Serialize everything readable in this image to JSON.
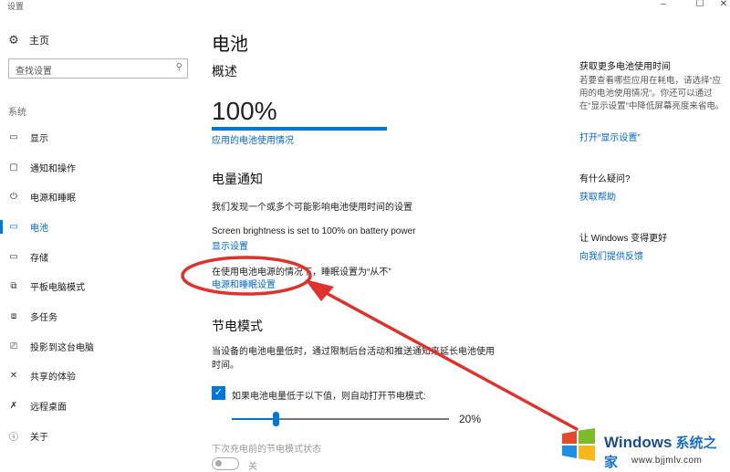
{
  "window": {
    "title": "设置",
    "controls": {
      "minimize": "–",
      "maximize": "☐",
      "close": "✕"
    }
  },
  "sidebar": {
    "home_label": "主页",
    "search_placeholder": "查找设置",
    "section_label": "系统",
    "items": [
      {
        "label": "显示",
        "icon": "monitor-icon",
        "glyph": "▭"
      },
      {
        "label": "通知和操作",
        "icon": "notification-icon",
        "glyph": "▢"
      },
      {
        "label": "电源和睡眠",
        "icon": "power-icon",
        "glyph": "⏻"
      },
      {
        "label": "电池",
        "icon": "battery-icon",
        "glyph": "▭",
        "active": true
      },
      {
        "label": "存储",
        "icon": "storage-icon",
        "glyph": "▭"
      },
      {
        "label": "平板电脑模式",
        "icon": "tablet-icon",
        "glyph": "⧉"
      },
      {
        "label": "多任务",
        "icon": "multitask-icon",
        "glyph": "⧈"
      },
      {
        "label": "投影到这台电脑",
        "icon": "project-icon",
        "glyph": "⎚"
      },
      {
        "label": "共享的体验",
        "icon": "share-icon",
        "glyph": "✕"
      },
      {
        "label": "远程桌面",
        "icon": "remote-desktop-icon",
        "glyph": "✗"
      },
      {
        "label": "关于",
        "icon": "info-icon",
        "glyph": "ⓘ"
      }
    ]
  },
  "main": {
    "title": "电池",
    "overview": {
      "heading": "概述",
      "percent": "100%",
      "level": 1.0,
      "usage_link": "应用的电池使用情况"
    },
    "notifications": {
      "heading": "电量通知",
      "found_text": "我们发现一个或多个可能影响电池使用时间的设置",
      "brightness_text": "Screen brightness is set to 100% on battery power",
      "display_link": "显示设置",
      "sleep_text": "在使用电池电源的情况下，睡眠设置为“从不”",
      "power_sleep_link": "电源和睡眠设置"
    },
    "saver": {
      "heading": "节电模式",
      "description": "当设备的电池电量低时，通过限制后台活动和推送通知来延长电池使用时间。",
      "checkbox_checked": true,
      "checkbox_label": "如果电池电量低于以下值，则自动打开节电模式:",
      "slider_value_text": "20%",
      "slider_value": 0.2,
      "next_charge_label": "下次充电前的节电模式状态",
      "toggle_label": "关",
      "toggle_on": false
    }
  },
  "right": {
    "more_heading": "获取更多电池使用时间",
    "more_text": "若要查看哪些应用在耗电，请选择“应用的电池使用情况”。你还可以通过在“显示设置”中降低屏幕亮度来省电。",
    "open_display_link": "打开“显示设置”",
    "question_heading": "有什么疑问?",
    "help_link": "获取帮助",
    "better_heading": "让 Windows 变得更好",
    "feedback_link": "向我们提供反馈"
  },
  "watermark": {
    "brand": "Windows",
    "brand_cn": "系统之家",
    "url": "www.bjjmlv.com"
  },
  "colors": {
    "accent": "#0078d7",
    "link": "#0066cc",
    "annotation": "#e0322d"
  }
}
